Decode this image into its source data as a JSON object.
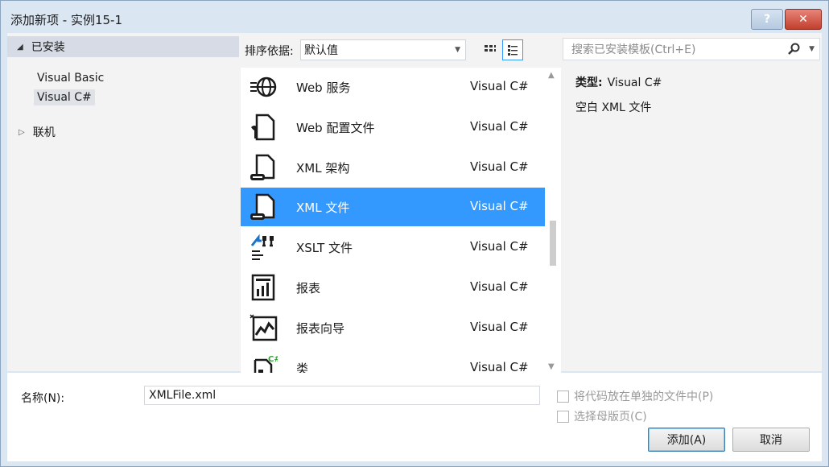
{
  "window": {
    "title": "添加新项 - 实例15-1",
    "help_label": "?",
    "close_label": "✕"
  },
  "tree": {
    "installed_label": "已安装",
    "items": [
      {
        "label": "Visual Basic",
        "selected": false
      },
      {
        "label": "Visual C#",
        "selected": true
      }
    ],
    "online_label": "联机"
  },
  "toolbar": {
    "sort_label": "排序依据:",
    "sort_value": "默认值",
    "grid_view_icon": "grid-view-icon",
    "list_view_icon": "list-view-icon"
  },
  "templates": [
    {
      "name": "Web 服务",
      "type": "Visual C#",
      "icon": "web-service-icon",
      "selected": false
    },
    {
      "name": "Web 配置文件",
      "type": "Visual C#",
      "icon": "web-config-icon",
      "selected": false
    },
    {
      "name": "XML 架构",
      "type": "Visual C#",
      "icon": "xml-schema-icon",
      "selected": false
    },
    {
      "name": "XML 文件",
      "type": "Visual C#",
      "icon": "xml-file-icon",
      "selected": true
    },
    {
      "name": "XSLT 文件",
      "type": "Visual C#",
      "icon": "xslt-file-icon",
      "selected": false
    },
    {
      "name": "报表",
      "type": "Visual C#",
      "icon": "report-icon",
      "selected": false
    },
    {
      "name": "报表向导",
      "type": "Visual C#",
      "icon": "report-wizard-icon",
      "selected": false
    },
    {
      "name": "类",
      "type": "Visual C#",
      "icon": "class-icon",
      "selected": false
    }
  ],
  "search": {
    "placeholder": "搜索已安装模板(Ctrl+E)"
  },
  "details": {
    "type_label": "类型:",
    "type_value": "Visual C#",
    "description": "空白 XML 文件"
  },
  "form": {
    "name_label": "名称(N):",
    "name_value": "XMLFile.xml",
    "separate_file_label": "将代码放在单独的文件中(P)",
    "master_page_label": "选择母版页(C)",
    "add_label": "添加(A)",
    "cancel_label": "取消"
  },
  "colors": {
    "selection": "#3399ff",
    "frame": "#dbe6f3"
  }
}
